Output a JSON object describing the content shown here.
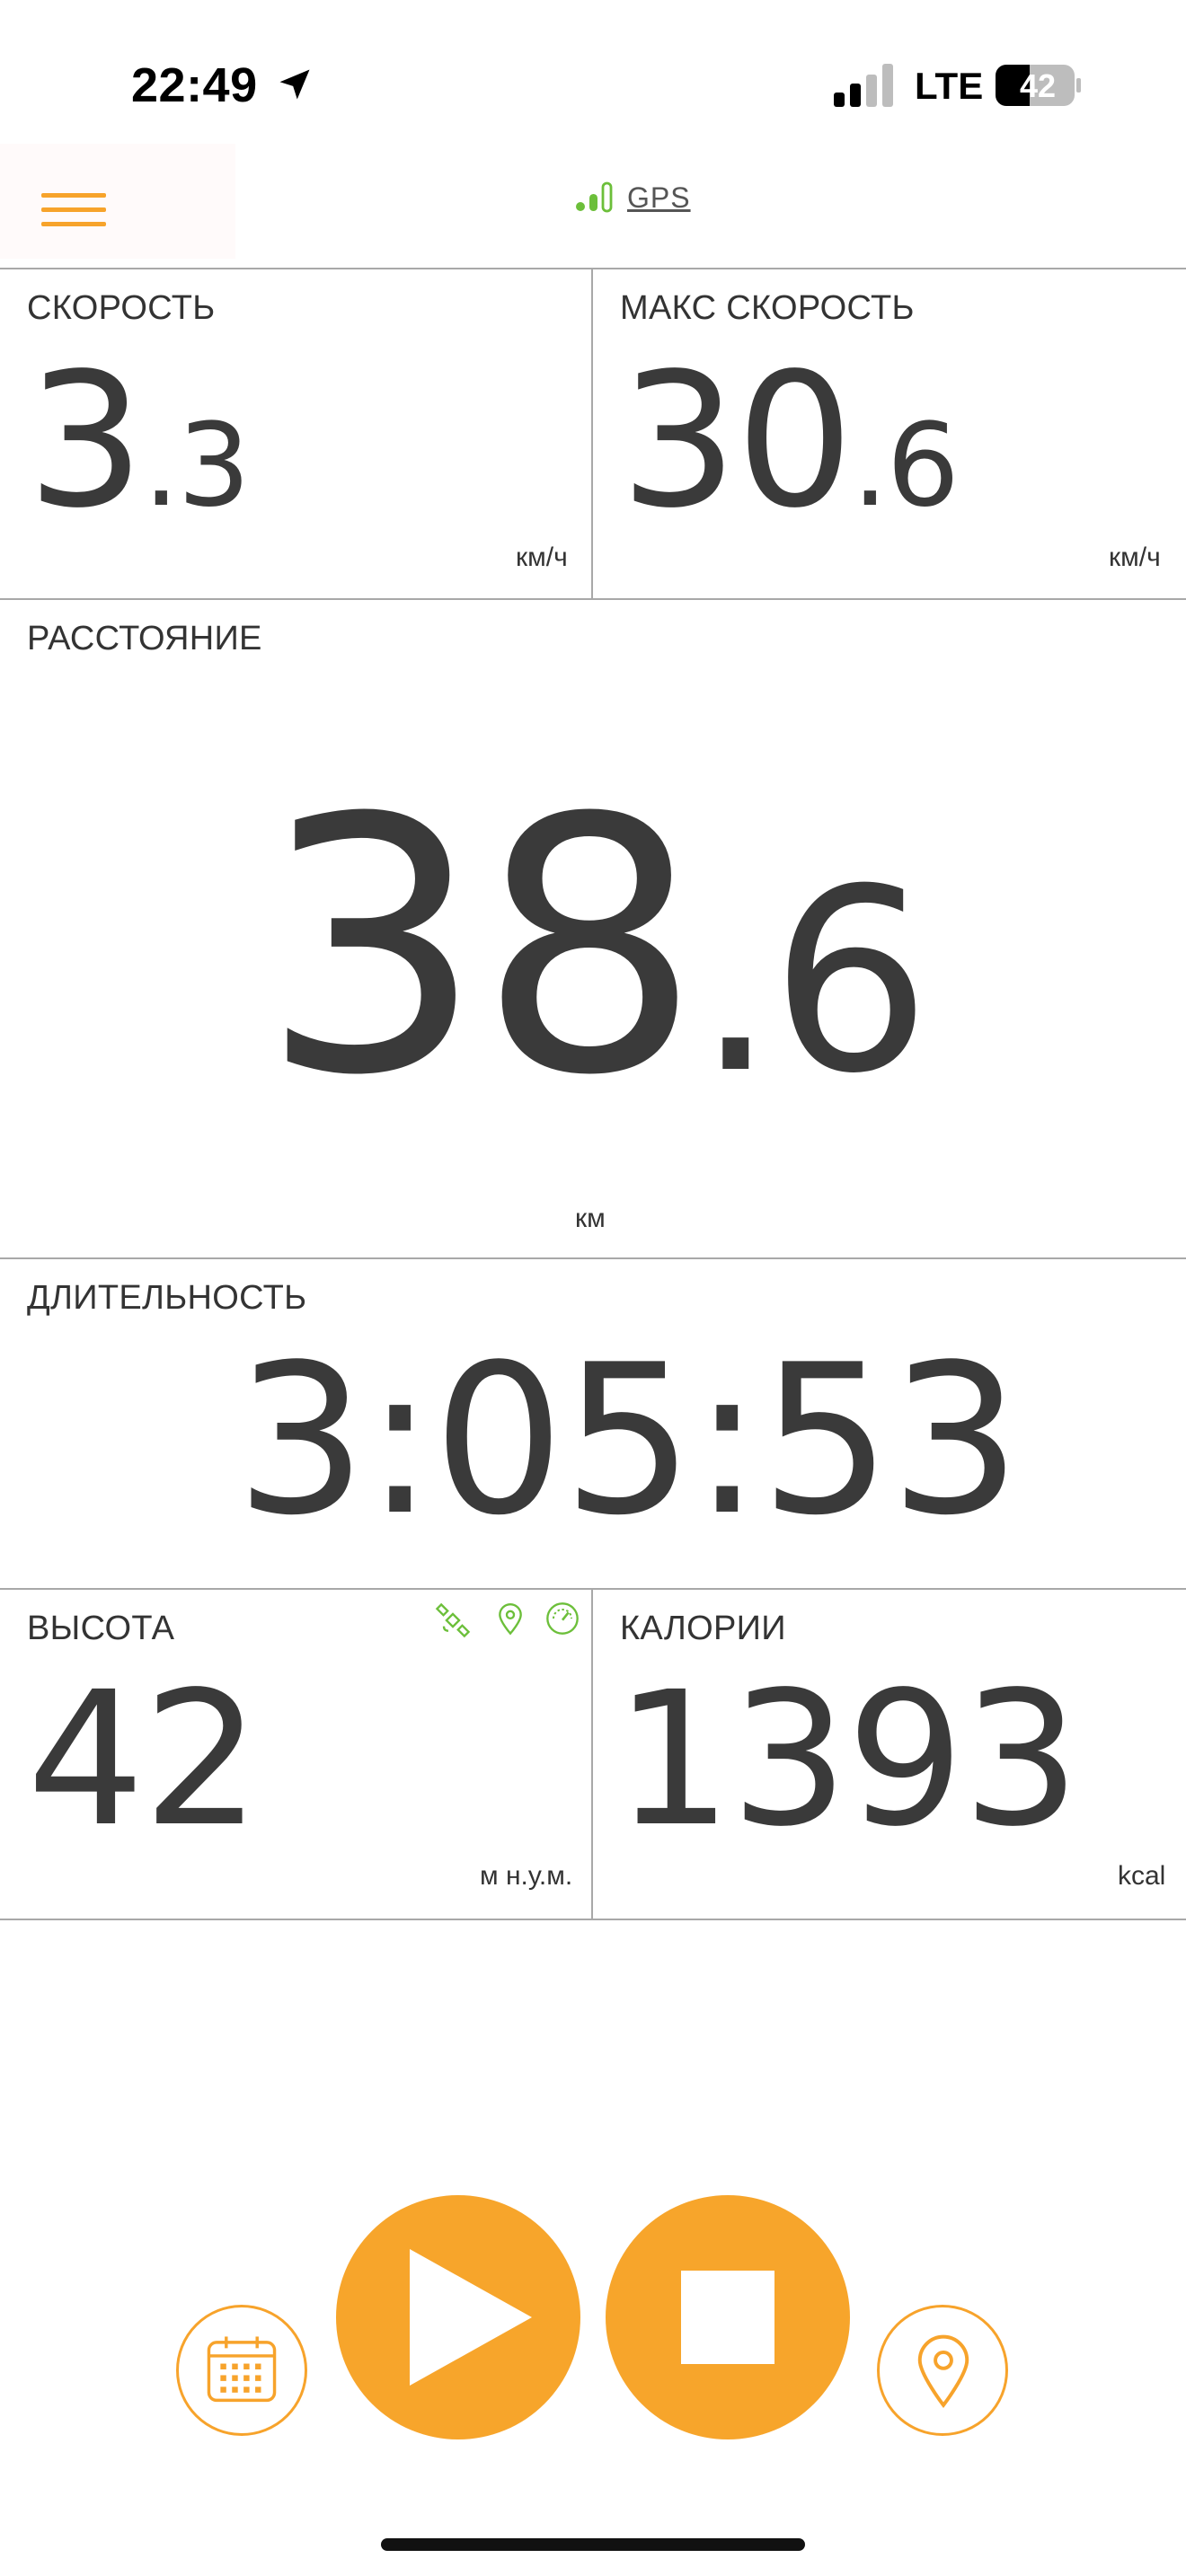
{
  "status_bar": {
    "time": "22:49",
    "network": "LTE",
    "battery": "42",
    "location_icon": "location-arrow-icon",
    "signal_icon": "cellular-signal-icon"
  },
  "header": {
    "menu_icon": "hamburger-menu-icon",
    "gps_label": "GPS",
    "gps_icon": "gps-signal-bars-icon"
  },
  "metrics": {
    "speed": {
      "label": "СКОРОСТЬ",
      "int": "3",
      "dec": ".3",
      "unit": "км/ч"
    },
    "max_speed": {
      "label": "МАКС СКОРОСТЬ",
      "int": "30",
      "dec": ".6",
      "unit": "км/ч"
    },
    "distance": {
      "label": "РАССТОЯНИЕ",
      "int": "38",
      "dec": ".6",
      "unit": "км"
    },
    "duration": {
      "label": "ДЛИТЕЛЬНОСТЬ",
      "value": "3:05:53"
    },
    "altitude": {
      "label": "ВЫСОТА",
      "value": "42",
      "unit": "м н.у.м.",
      "source_icons": [
        "satellite-icon",
        "map-pin-icon",
        "gauge-icon"
      ]
    },
    "calories": {
      "label": "КАЛОРИИ",
      "value": "1393",
      "unit": "kcal"
    }
  },
  "controls": {
    "calendar_icon": "calendar-icon",
    "play_icon": "play-icon",
    "stop_icon": "stop-icon",
    "map_pin_icon": "map-pin-icon"
  },
  "colors": {
    "accent": "#f7a52b",
    "gps_green": "#6cbf3a",
    "text": "#3a3a3a"
  }
}
